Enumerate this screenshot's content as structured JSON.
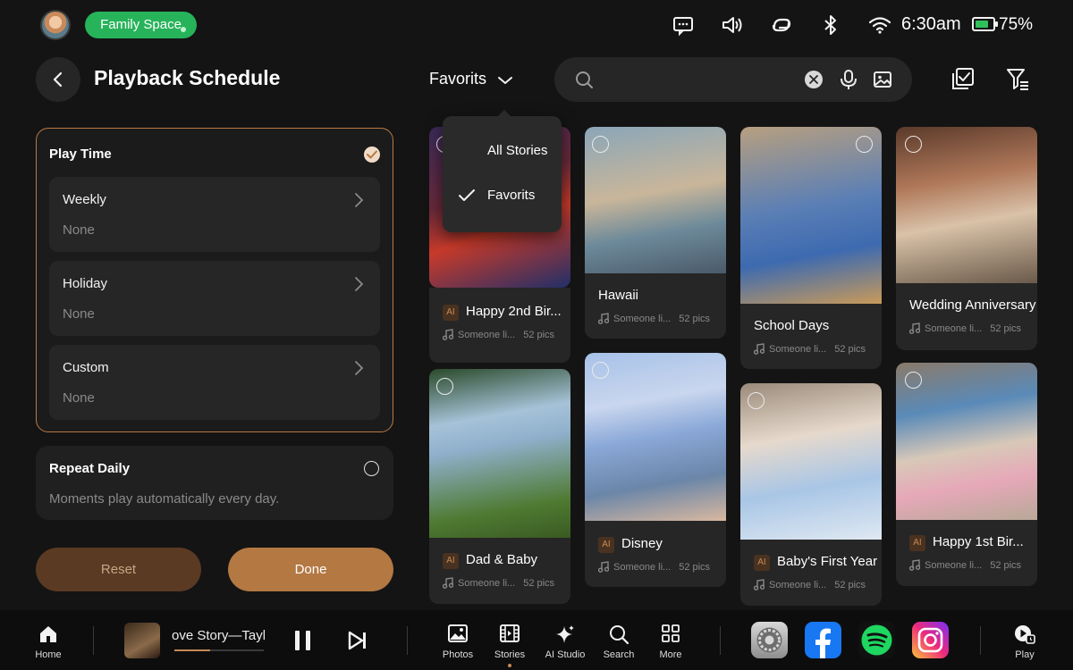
{
  "status": {
    "family_space": "Family Space",
    "time": "6:30am",
    "battery_pct": "75%",
    "battery_level": 0.75,
    "icons": [
      "message-icon",
      "volume-icon",
      "link-icon",
      "bluetooth-icon",
      "wifi-icon",
      "battery-icon"
    ]
  },
  "header": {
    "title": "Playback Schedule",
    "filter_label": "Favorits",
    "search_placeholder": "",
    "search_value": ""
  },
  "dropdown": {
    "items": [
      {
        "label": "All Stories",
        "checked": false
      },
      {
        "label": "Favorits",
        "checked": true
      }
    ]
  },
  "play_time": {
    "title": "Play Time",
    "options": [
      {
        "label": "Weekly",
        "value": "None"
      },
      {
        "label": "Holiday",
        "value": "None"
      },
      {
        "label": "Custom",
        "value": "None"
      }
    ]
  },
  "repeat": {
    "title": "Repeat Daily",
    "desc": "Moments play automatically every day."
  },
  "buttons": {
    "reset": "Reset",
    "done": "Done"
  },
  "stories": [
    {
      "name": "Happy 2nd Bir...",
      "ai": true,
      "ai_label": "AI",
      "music": "Someone li...",
      "pics": "52 pics"
    },
    {
      "name": "Hawaii",
      "ai": false,
      "music": "Someone li...",
      "pics": "52 pics"
    },
    {
      "name": "School Days",
      "ai": false,
      "music": "Someone li...",
      "pics": "52 pics"
    },
    {
      "name": "Wedding Anniversary",
      "ai": false,
      "music": "Someone li...",
      "pics": "52 pics"
    },
    {
      "name": "Dad & Baby",
      "ai": true,
      "ai_label": "AI",
      "music": "Someone li...",
      "pics": "52 pics"
    },
    {
      "name": "Disney",
      "ai": true,
      "ai_label": "AI",
      "music": "Someone li...",
      "pics": "52 pics"
    },
    {
      "name": "Baby's First Year",
      "ai": true,
      "ai_label": "AI",
      "music": "Someone li...",
      "pics": "52 pics"
    },
    {
      "name": "Happy 1st Bir...",
      "ai": true,
      "ai_label": "AI",
      "music": "Someone li...",
      "pics": "52 pics"
    }
  ],
  "dock": {
    "home": "Home",
    "now_playing": "ove Story—Tayl",
    "progress": 0.4,
    "photos": "Photos",
    "stories": "Stories",
    "ai_studio": "AI Studio",
    "search": "Search",
    "more": "More",
    "play": "Play",
    "apps": [
      "settings-app-icon",
      "facebook-app-icon",
      "spotify-app-icon",
      "instagram-app-icon"
    ]
  }
}
